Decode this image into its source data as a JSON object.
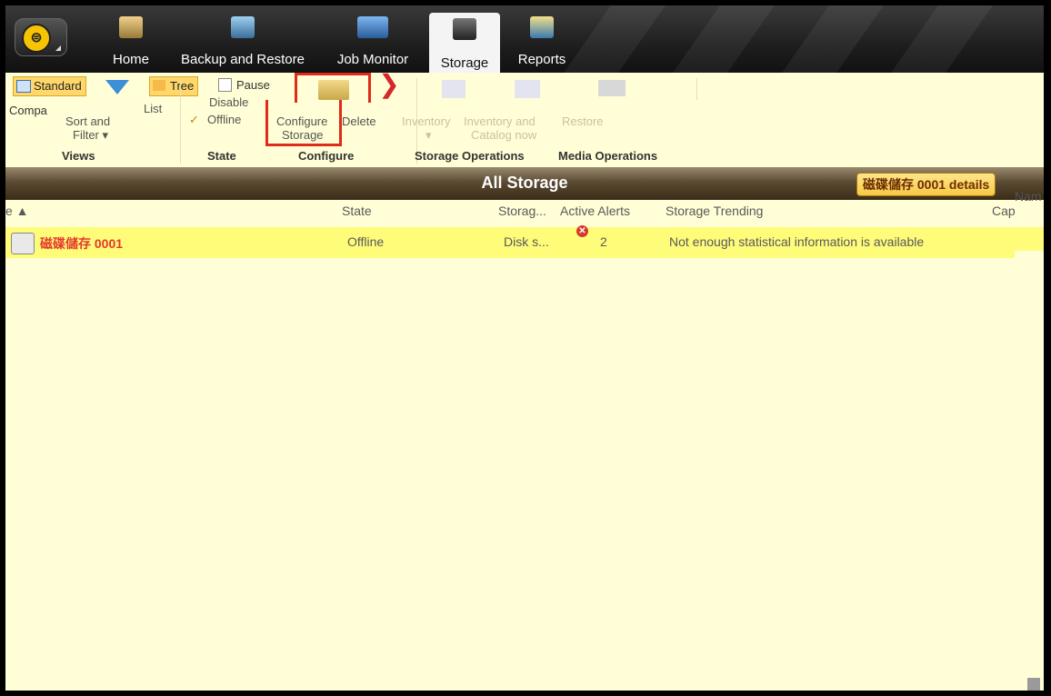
{
  "colors": {
    "ribbon_bg": "#fffed6",
    "highlight_row": "#fffc7a",
    "annotation_red": "#e02a1a",
    "error_text": "#e3392c"
  },
  "top_tabs": [
    {
      "label": "Home",
      "icon": "home-icon"
    },
    {
      "label": "Backup and Restore",
      "icon": "backup-restore-icon"
    },
    {
      "label": "Job Monitor",
      "icon": "job-monitor-icon"
    },
    {
      "label": "Storage",
      "icon": "storage-icon",
      "active": true
    },
    {
      "label": "Reports",
      "icon": "reports-icon"
    }
  ],
  "ribbon": {
    "views": {
      "standard": "Standard",
      "tree": "Tree",
      "compact": "Compa",
      "list": "List",
      "sort_filter_1": "Sort and",
      "sort_filter_2": "Filter ▾",
      "group": "Views"
    },
    "state": {
      "pause": "Pause",
      "disable": "Disable",
      "offline": "Offline",
      "group": "State"
    },
    "configure": {
      "configure_1": "Configure",
      "configure_2": "Storage",
      "delete": "Delete",
      "group": "Configure"
    },
    "storage_ops": {
      "inventory": "Inventory",
      "inventory_arrow": "▾",
      "inventory_catalog_1": "Inventory and",
      "inventory_catalog_2": "Catalog now",
      "group": "Storage Operations"
    },
    "media_ops": {
      "restore": "Restore",
      "group": "Media Operations"
    }
  },
  "panel": {
    "title": "All Storage",
    "details_button": "磁碟儲存 0001 details",
    "name_cut": "Nam"
  },
  "table": {
    "columns": [
      "e ▲",
      "State",
      "Storag...",
      "Active Alerts",
      "Storage Trending",
      "Cap"
    ],
    "rows": [
      {
        "name": "磁碟儲存 0001",
        "state": "Offline",
        "storage": "Disk s...",
        "alerts": "2",
        "trending": "Not enough statistical information is available"
      }
    ]
  }
}
